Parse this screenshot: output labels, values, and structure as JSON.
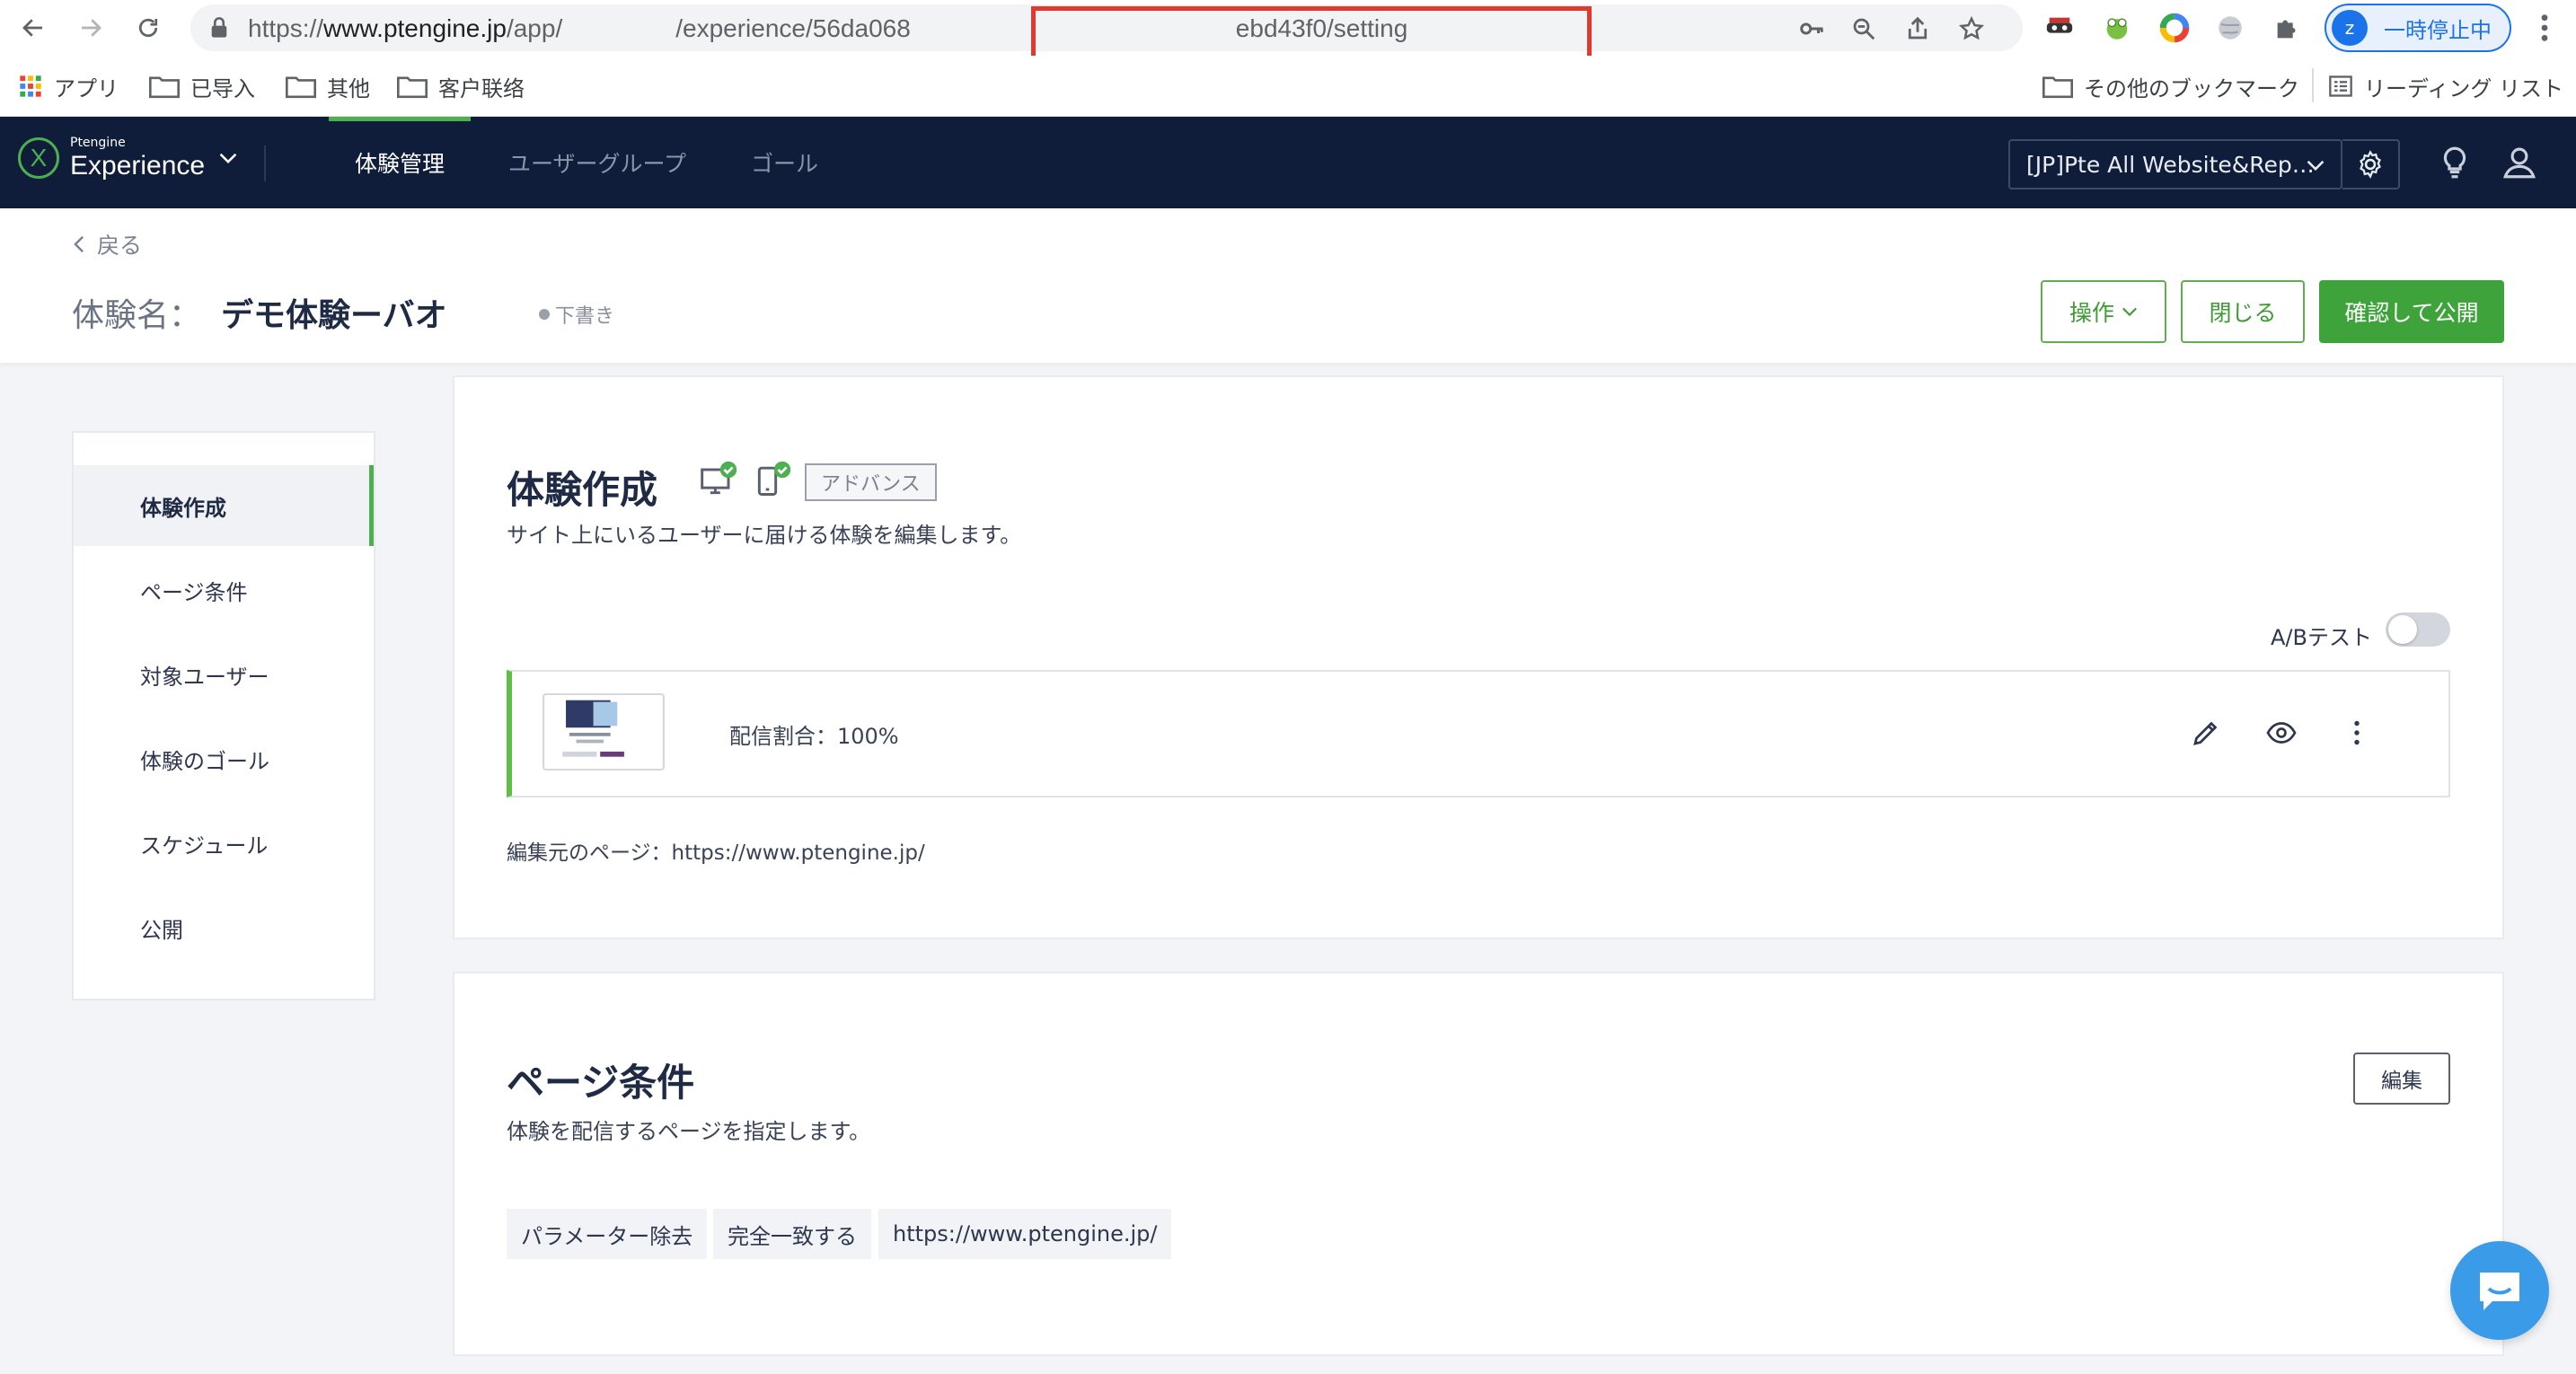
{
  "browser": {
    "url_prefix": "https://",
    "url_domain": "www.ptengine.jp",
    "url_path_1": "/app/",
    "url_path_2": "/experience",
    "url_id_start": "/56da068",
    "url_id_end": "ebd43f0/",
    "url_tail": "setting",
    "profile_letter": "z",
    "profile_status": "一時停止中"
  },
  "bookmarks": {
    "apps": "アプリ",
    "items": [
      "已导入",
      "其他",
      "客户联络"
    ],
    "other": "その他のブックマーク",
    "reading_list": "リーディング リスト"
  },
  "appbar": {
    "logo_small": "Ptengine",
    "logo_big": "Experience",
    "tabs": [
      "体験管理",
      "ユーザーグループ",
      "ゴール"
    ],
    "project": "[JP]Pte All Website&Rep…"
  },
  "page": {
    "back": "戻る",
    "name_label": "体験名：",
    "name_value": "デモ体験ーバオ",
    "status": "下書き",
    "btn_operate": "操作",
    "btn_close": "閉じる",
    "btn_publish": "確認して公開"
  },
  "sidebar": {
    "items": [
      "体験作成",
      "ページ条件",
      "対象ユーザー",
      "体験のゴール",
      "スケジュール",
      "公開"
    ]
  },
  "create": {
    "title": "体験作成",
    "tag": "アドバンス",
    "desc": "サイト上にいるユーザーに届ける体験を編集します。",
    "ab_label": "A/Bテスト",
    "ab_enabled": false,
    "variant_text": "配信割合：100%",
    "source": "編集元のページ：https://www.ptengine.jp/"
  },
  "page_cond": {
    "title": "ページ条件",
    "desc": "体験を配信するページを指定します。",
    "edit": "編集",
    "chips": [
      "パラメーター除去",
      "完全一致する",
      "https://www.ptengine.jp/"
    ]
  },
  "colors": {
    "accent_green": "#3ea33a",
    "header_navy": "#0f1c3a",
    "redact_box": "#e03a2f"
  }
}
